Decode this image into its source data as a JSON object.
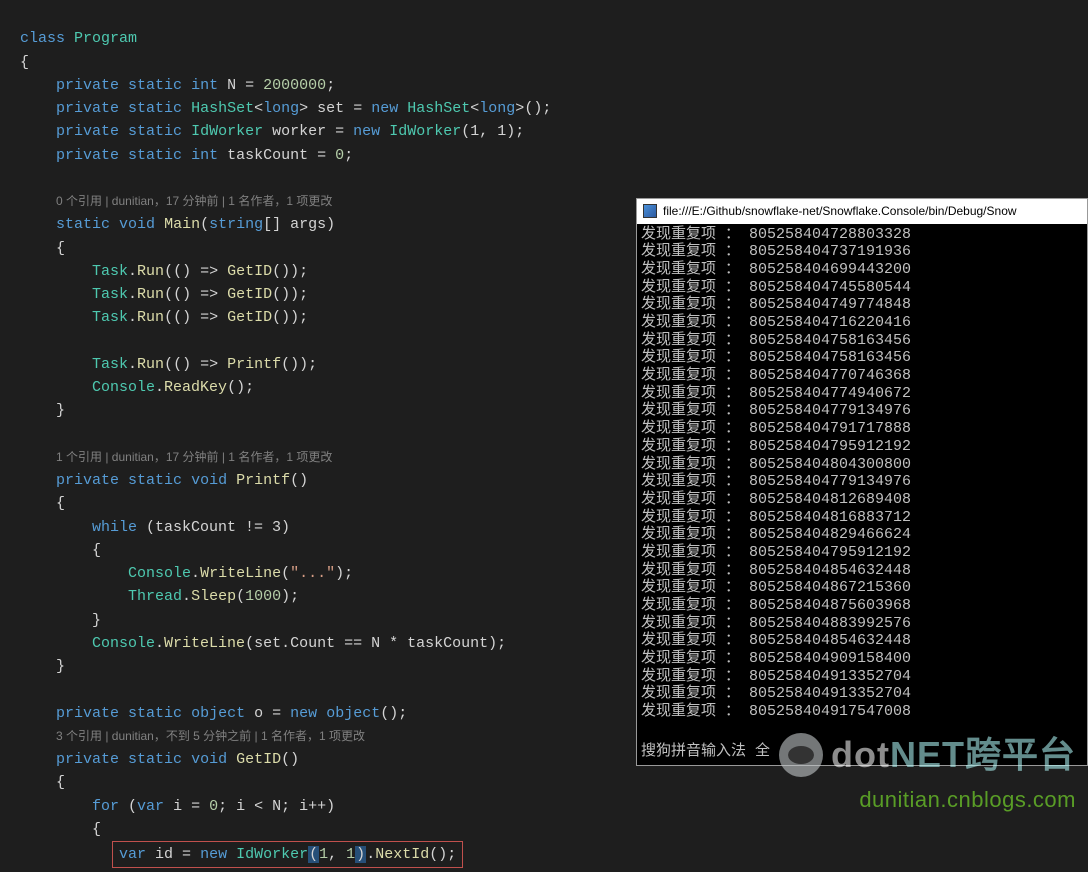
{
  "code": {
    "classKw": "class",
    "className": "Program",
    "braceOpen": "{",
    "braceClose": "}",
    "f1": {
      "private": "private",
      "static": "static",
      "type": "int",
      "name": "N",
      "eq": "=",
      "val": "2000000",
      "semi": ";"
    },
    "f2": {
      "private": "private",
      "static": "static",
      "type": "HashSet",
      "lt": "<",
      "inner": "long",
      "gt": ">",
      "name": "set",
      "eq": "=",
      "new": "new",
      "type2": "HashSet",
      "inner2": "long",
      "ctor": "();"
    },
    "f3": {
      "private": "private",
      "static": "static",
      "type": "IdWorker",
      "name": "worker",
      "eq": "=",
      "new": "new",
      "type2": "IdWorker",
      "args": "(1, 1);"
    },
    "f4": {
      "private": "private",
      "static": "static",
      "type": "int",
      "name": "taskCount",
      "eq": "=",
      "val": "0",
      "semi": ";"
    },
    "codelens1": "0 个引用 | dunitian，17 分钟前 | 1 名作者，1 项更改",
    "mainSig": {
      "static": "static",
      "void": "void",
      "name": "Main",
      "paren": "(",
      "ptype": "string",
      "arr": "[]",
      "pname": " args",
      "paren2": ")"
    },
    "taskRun": {
      "Task": "Task",
      "dot": ".",
      "Run": "Run",
      "body": "(() => ",
      "GetID": "GetID",
      "end": "());"
    },
    "taskPrintf": {
      "Task": "Task",
      "dot": ".",
      "Run": "Run",
      "body": "(() => ",
      "Printf": "Printf",
      "end": "());"
    },
    "consoleRead": {
      "Console": "Console",
      "dot": ".",
      "ReadKey": "ReadKey",
      "end": "();"
    },
    "codelens2": "1 个引用 | dunitian，17 分钟前 | 1 名作者，1 项更改",
    "printfSig": {
      "private": "private",
      "static": "static",
      "void": "void",
      "name": "Printf",
      "paren": "()"
    },
    "whileSig": {
      "while": "while",
      "cond": " (taskCount != 3)"
    },
    "writeLineDots": {
      "Console": "Console",
      "dot": ".",
      "WriteLine": "WriteLine",
      "open": "(",
      "str": "\"...\"",
      "end": ");"
    },
    "threadSleep": {
      "Thread": "Thread",
      "dot": ".",
      "Sleep": "Sleep",
      "open": "(",
      "num": "1000",
      "end": ");"
    },
    "writeLineSet": {
      "Console": "Console",
      "dot": ".",
      "WriteLine": "WriteLine",
      "body": "(set.Count == N * taskCount);"
    },
    "objDecl": {
      "private": "private",
      "static": "static",
      "type": "object",
      "name": "o",
      "eq": "=",
      "new": "new",
      "type2": "object",
      "end": "();"
    },
    "codelens3": "3 个引用 | dunitian，不到 5 分钟之前 | 1 名作者，1 项更改",
    "getIdSig": {
      "private": "private",
      "static": "static",
      "void": "void",
      "name": "GetID",
      "paren": "()"
    },
    "forSig": {
      "for": "for",
      "open": " (",
      "var": "var",
      "body1": " i = ",
      "zero": "0",
      "body2": "; i < N; i++)"
    },
    "idLine": {
      "var": "var",
      "body1": " id = ",
      "new": "new",
      "type": "IdWorker",
      "open": "(",
      "a1": "1",
      "comma": ", ",
      "a2": "1",
      "close": ")",
      "dot": ".",
      "NextId": "NextId",
      "end": "();"
    }
  },
  "console": {
    "title": "file:///E:/Github/snowflake-net/Snowflake.Console/bin/Debug/Snow",
    "prefix": "发现重复项 ：",
    "ids": [
      "805258404728803328",
      "805258404737191936",
      "805258404699443200",
      "805258404745580544",
      "805258404749774848",
      "805258404716220416",
      "805258404758163456",
      "805258404758163456",
      "805258404770746368",
      "805258404774940672",
      "805258404779134976",
      "805258404791717888",
      "805258404795912192",
      "805258404804300800",
      "805258404779134976",
      "805258404812689408",
      "805258404816883712",
      "805258404829466624",
      "805258404795912192",
      "805258404854632448",
      "805258404867215360",
      "805258404875603968",
      "805258404883992576",
      "805258404854632448",
      "805258404909158400",
      "805258404913352704",
      "805258404913352704",
      "805258404917547008"
    ],
    "footer": "搜狗拼音输入法 全"
  },
  "watermark": {
    "line1a": "dot",
    "line1b": "NET跨平台",
    "line2": "dunitian.cnblogs.com"
  }
}
